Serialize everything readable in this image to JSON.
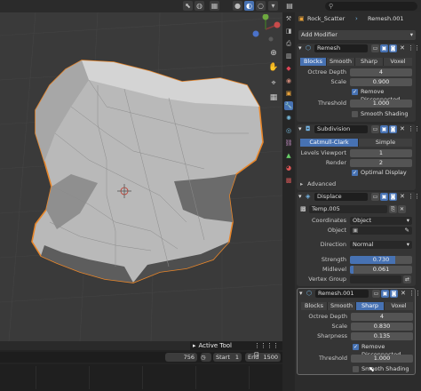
{
  "viewport": {
    "header_icons": [
      "cursor-icon",
      "globe-icon",
      "mesh-icon",
      "solid-shading-icon",
      "material-shading-icon",
      "render-shading-icon"
    ],
    "nav_icons": [
      "zoom-icon",
      "hand-icon",
      "camera-icon",
      "grid-icon"
    ]
  },
  "timeline": {
    "frame": "756",
    "start_label": "Start",
    "start_value": "1",
    "end_label": "End",
    "end_value": "1500",
    "popup_label": "Active Tool"
  },
  "properties": {
    "search_placeholder": "",
    "object_name": "Rock_Scatter",
    "mesh_name": "Remesh.001",
    "add_modifier": "Add Modifier",
    "remesh": {
      "name": "Remesh",
      "modes": [
        "Blocks",
        "Smooth",
        "Sharp",
        "Voxel"
      ],
      "active_mode": "Blocks",
      "octree_label": "Octree Depth",
      "octree_value": "4",
      "scale_label": "Scale",
      "scale_value": "0.900",
      "remove_disconnected": "Remove Disconnected",
      "threshold_label": "Threshold",
      "threshold_value": "1.000",
      "smooth_shading": "Smooth Shading"
    },
    "subdivision": {
      "name": "Subdivision",
      "types": [
        "Catmull-Clark",
        "Simple"
      ],
      "levels_label": "Levels Viewport",
      "levels_value": "1",
      "render_label": "Render",
      "render_value": "2",
      "optimal_display": "Optimal Display",
      "advanced": "Advanced"
    },
    "displace": {
      "name": "Displace",
      "texture": "Temp.005",
      "coordinates_label": "Coordinates",
      "coordinates_value": "Object",
      "object_label": "Object",
      "object_value": "",
      "direction_label": "Direction",
      "direction_value": "Normal",
      "strength_label": "Strength",
      "strength_value": "0.730",
      "strength_fill": 0.73,
      "midlevel_label": "Midlevel",
      "midlevel_value": "0.061",
      "midlevel_fill": 0.061,
      "vertex_group_label": "Vertex Group",
      "vertex_group_value": ""
    },
    "remesh2": {
      "name": "Remesh.001",
      "modes": [
        "Blocks",
        "Smooth",
        "Sharp",
        "Voxel"
      ],
      "active_mode": "Sharp",
      "octree_label": "Octree Depth",
      "octree_value": "4",
      "scale_label": "Scale",
      "scale_value": "0.830",
      "sharpness_label": "Sharpness",
      "sharpness_value": "0.135",
      "remove_disconnected": "Remove Disconnected",
      "threshold_label": "Threshold",
      "threshold_value": "1.000",
      "smooth_shading": "Smooth Shading"
    }
  },
  "colors": {
    "accent": "#4772b3",
    "selection_outline": "#e8862a",
    "panel_bg": "#353535"
  }
}
